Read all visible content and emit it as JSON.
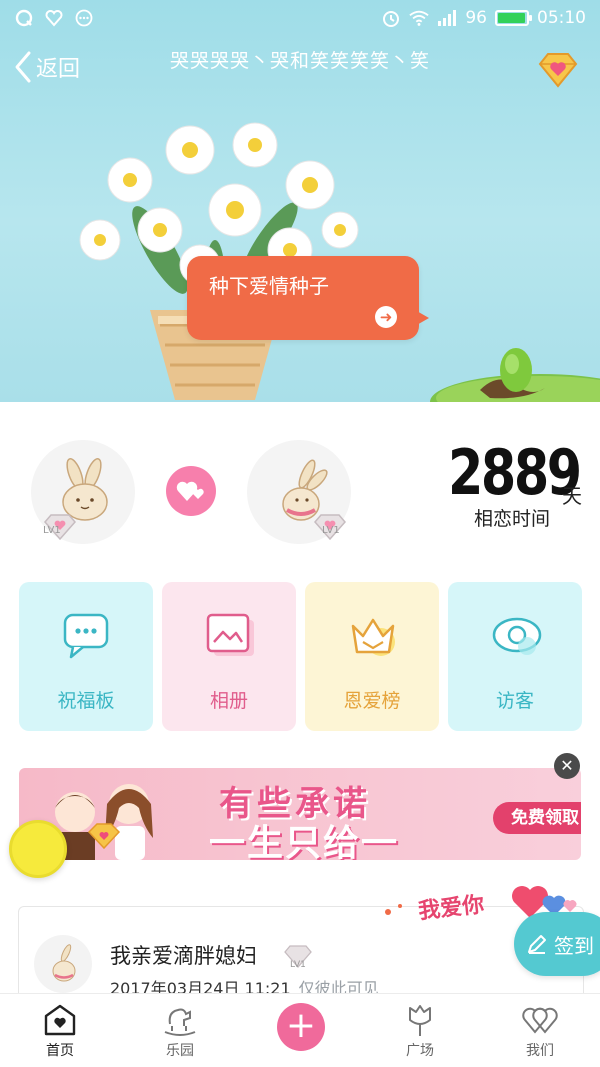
{
  "status_bar": {
    "battery_level": "96",
    "time": "05:10"
  },
  "header": {
    "back_label": "返回",
    "title": "哭哭哭哭丶哭和笑笑笑笑丶笑"
  },
  "hero": {
    "seed_bubble_text": "种下爱情种子"
  },
  "couple": {
    "left_level": "LV1",
    "right_level": "LV1",
    "days_value": "2889",
    "days_unit": "天",
    "days_label": "相恋时间"
  },
  "features": [
    {
      "label": "祝福板",
      "bg": "#d6f6f9",
      "color": "#3bb6c4"
    },
    {
      "label": "相册",
      "bg": "#fce6ee",
      "color": "#e05d8c"
    },
    {
      "label": "恩爱榜",
      "bg": "#fdf5d5",
      "color": "#e5a33b"
    },
    {
      "label": "访客",
      "bg": "#d6f6f9",
      "color": "#3bb6c4"
    }
  ],
  "banner": {
    "title": "有些承诺",
    "subtitle": "一生只给一",
    "button_label": "免费领取"
  },
  "post": {
    "author": "我亲爱滴胖媳妇",
    "level": "LV1",
    "timestamp": "2017年03月24日 11:21",
    "visibility": "仅彼此可见",
    "sticker_text": "我爱你"
  },
  "checkin": {
    "label": "签到"
  },
  "bottom_nav": [
    {
      "label": "首页",
      "icon": "home-heart-icon"
    },
    {
      "label": "乐园",
      "icon": "rocking-horse-icon"
    },
    {
      "label": "广场",
      "icon": "tulip-icon"
    },
    {
      "label": "我们",
      "icon": "interlocked-hearts-icon"
    }
  ],
  "colors": {
    "accent_orange": "#f06b47",
    "accent_pink": "#f06a9b",
    "accent_teal": "#54c9d1"
  }
}
